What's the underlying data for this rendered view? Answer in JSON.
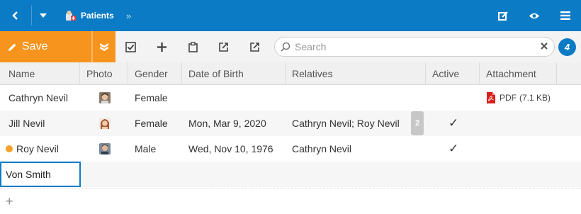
{
  "topbar": {
    "breadcrumb_label": "Patients",
    "breadcrumb_separator": "»",
    "icons": [
      "chevron-left-icon",
      "caret-down-icon",
      "patients-icon",
      "edit-icon",
      "eye-icon",
      "menu-icon"
    ]
  },
  "toolbar": {
    "save_label": "Save",
    "search_placeholder": "Search",
    "search_value": "",
    "record_count": "4",
    "icons": [
      "save-more-icon",
      "checkbox-icon",
      "plus-icon",
      "clipboard-icon",
      "export-icon",
      "share-icon",
      "search-icon",
      "clear-icon"
    ]
  },
  "columns": [
    "Name",
    "Photo",
    "Gender",
    "Date of Birth",
    "Relatives",
    "Active",
    "Attachment"
  ],
  "rows": [
    {
      "name": "Cathryn Nevil",
      "gender": "Female",
      "dob": "",
      "relatives": "",
      "relatives_more": "",
      "active": "",
      "attachment_type": "PDF",
      "attachment_size": "(7.1 KB)",
      "modified": false
    },
    {
      "name": "Jill Nevil",
      "gender": "Female",
      "dob": "Mon, Mar 9, 2020",
      "relatives": "Cathryn Nevil; Roy Nevil",
      "relatives_more": "2",
      "active": "✓",
      "attachment_type": "",
      "attachment_size": "",
      "modified": false
    },
    {
      "name": "Roy Nevil",
      "gender": "Male",
      "dob": "Wed, Nov 10, 1976",
      "relatives": "Cathryn Nevil",
      "relatives_more": "",
      "active": "✓",
      "attachment_type": "",
      "attachment_size": "",
      "modified": true
    }
  ],
  "edit_row": {
    "name_value": "Von Smith"
  },
  "add_row_label": "+",
  "colors": {
    "primary": "#0c7bc6",
    "accent": "#f7941d",
    "modified_dot": "#f7a02a"
  }
}
